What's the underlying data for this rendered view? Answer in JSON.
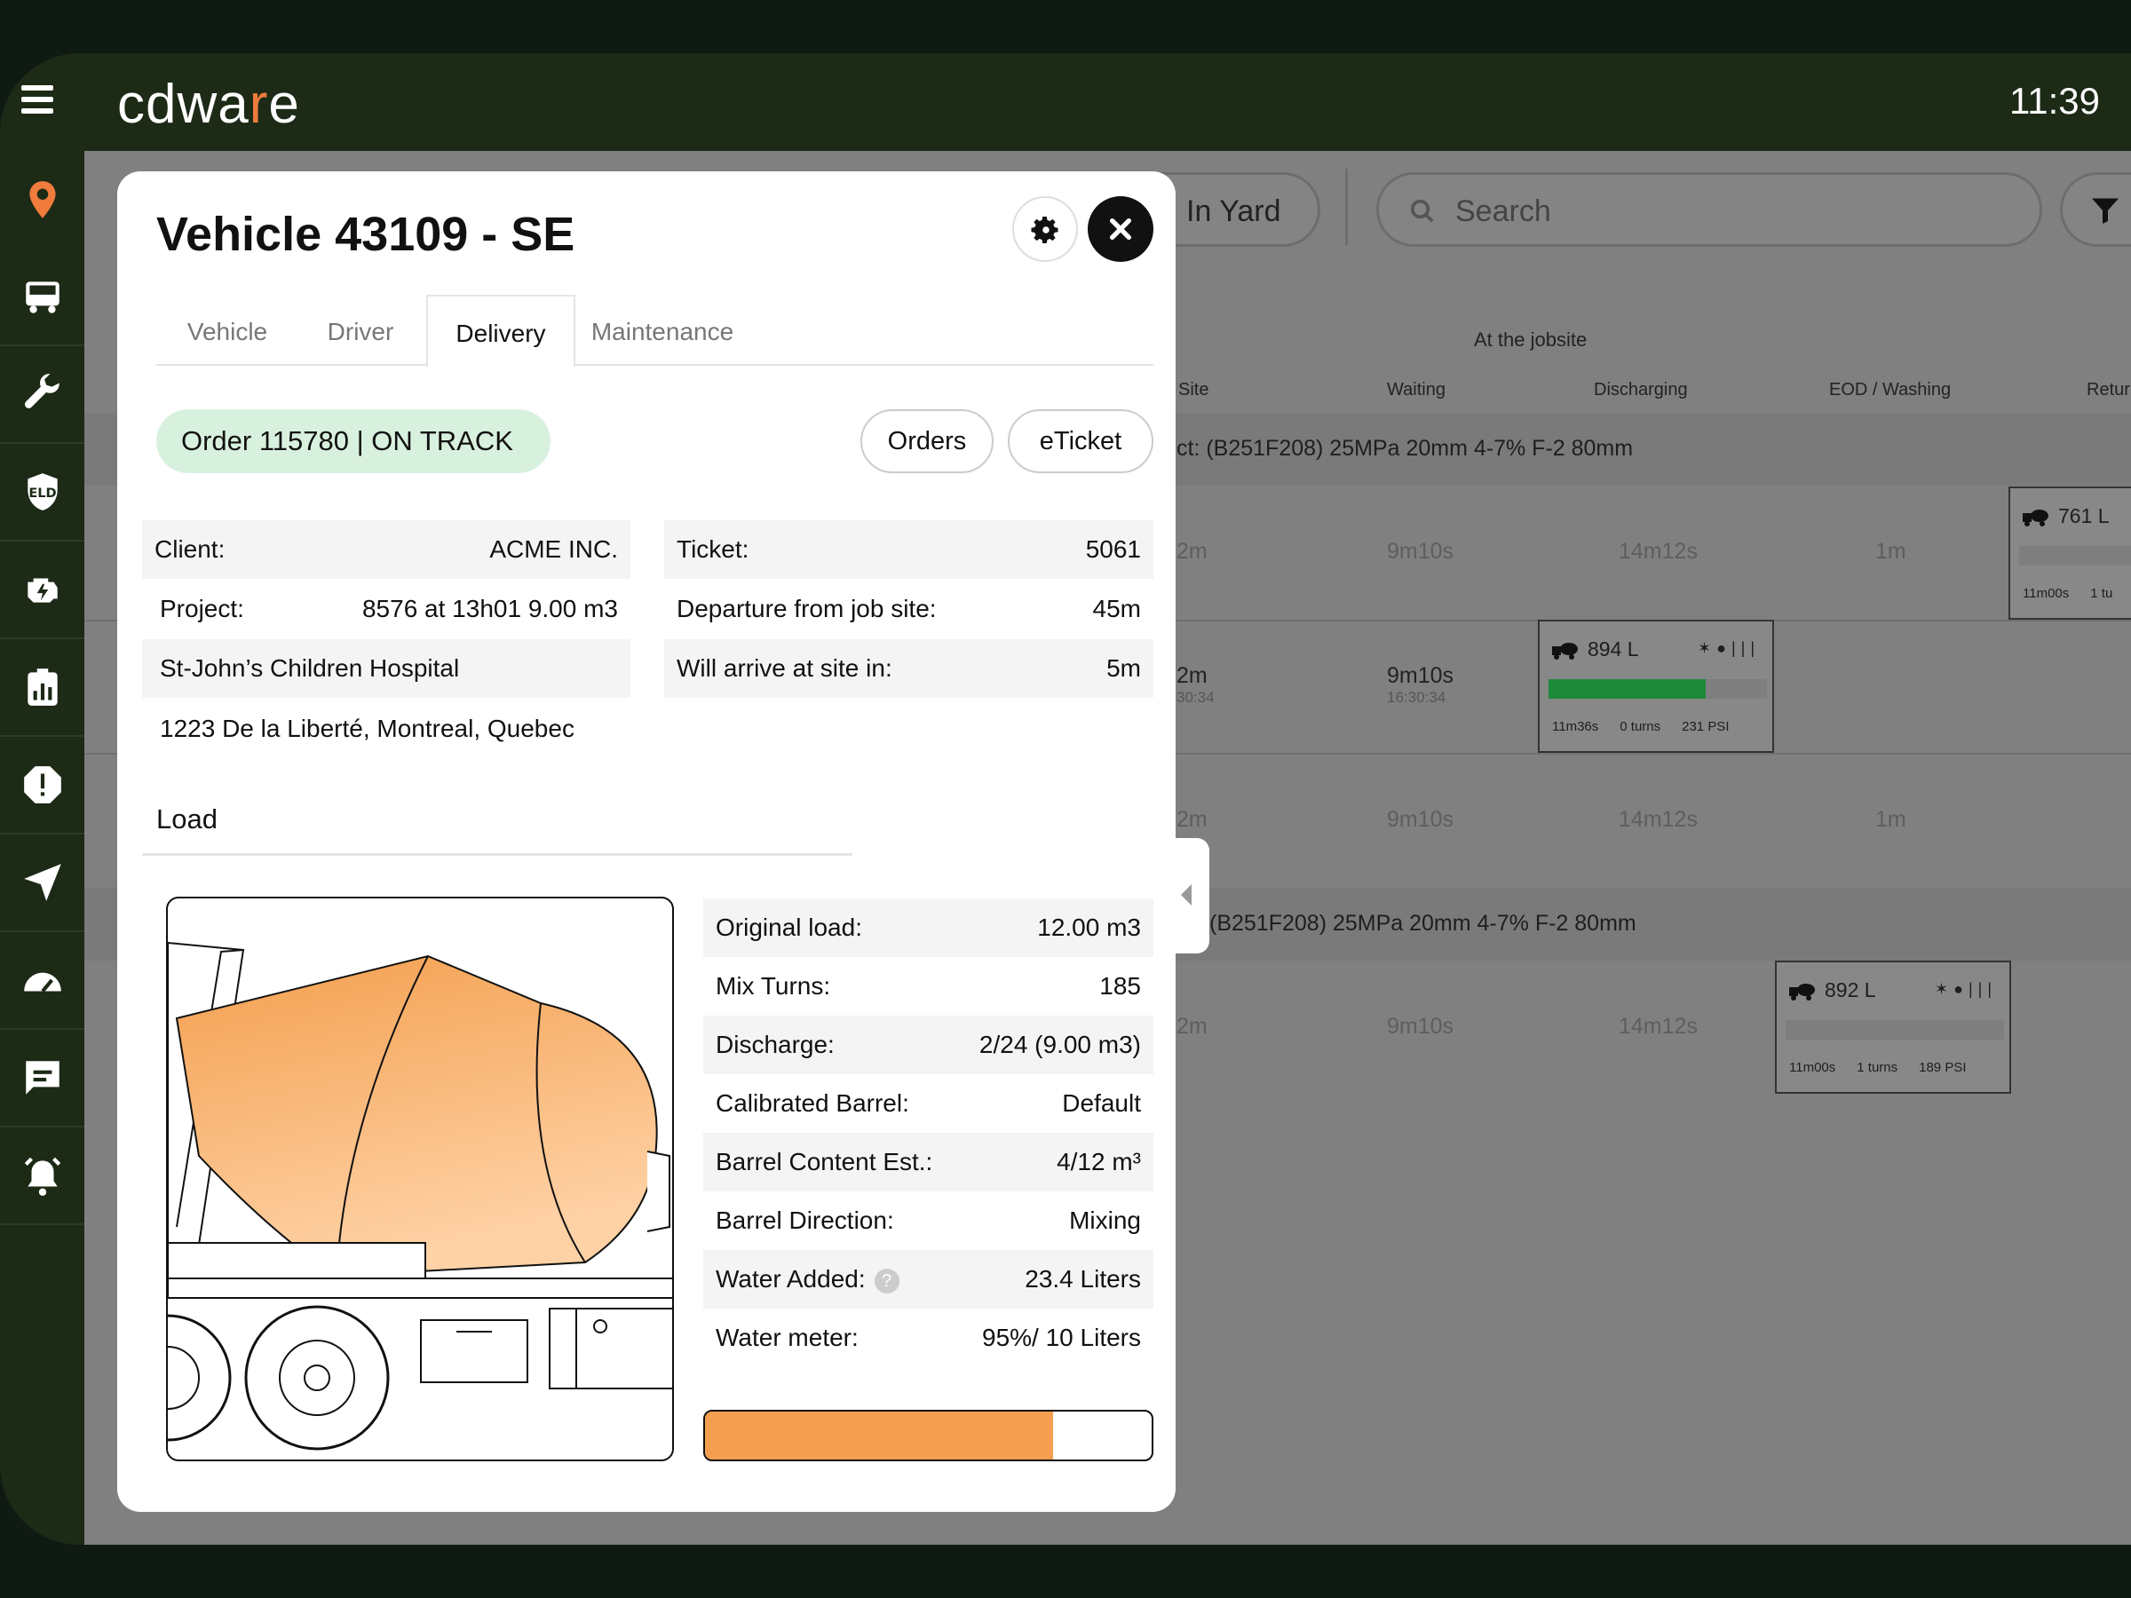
{
  "app": {
    "logo_pre": "cdwa",
    "logo_accent": "r",
    "logo_post": "e",
    "clock": "11:39"
  },
  "colors": {
    "accent": "#ef7b3d",
    "frame": "#1c2a16",
    "on_track_bg": "#d8f1de",
    "load_fill": "#f39f4f",
    "progress_green": "#1c8a3a"
  },
  "sidebar": {
    "items": [
      {
        "name": "location-pin-icon"
      },
      {
        "name": "truck-icon"
      },
      {
        "name": "wrench-icon"
      },
      {
        "name": "eld-shield-icon"
      },
      {
        "name": "engine-icon"
      },
      {
        "name": "report-chart-icon"
      },
      {
        "name": "alert-icon"
      },
      {
        "name": "navigation-icon"
      },
      {
        "name": "gauge-icon"
      },
      {
        "name": "chat-icon"
      },
      {
        "name": "alarm-bell-icon"
      }
    ]
  },
  "background": {
    "yard_label": "In Yard",
    "search_placeholder": "Search",
    "group_label": "At the jobsite",
    "columns": [
      "Site",
      "Waiting",
      "Discharging",
      "EOD / Washing",
      "Retur"
    ],
    "product_1": "ct: (B251F208) 25MPa 20mm 4-7% F-2 80mm",
    "product_2": "(B251F208) 25MPa 20mm 4-7% F-2 80mm",
    "rows": [
      {
        "c1": "2m",
        "c2": "9m10s",
        "c3": "14m12s",
        "c4": "1m"
      },
      {
        "c1": "2m",
        "c1_sub": "30:34",
        "c2": "9m10s",
        "c2_sub": "16:30:34"
      },
      {
        "c1": "2m",
        "c2": "9m10s",
        "c3": "14m12s",
        "c4": "1m"
      },
      {
        "c1": "2m",
        "c2": "9m10s",
        "c3": "14m12s"
      }
    ],
    "cards": [
      {
        "volume": "894 L",
        "progress": 0.72,
        "time": "11m36s",
        "turns": "0 turns",
        "psi": "231 PSI"
      },
      {
        "volume": "892 L",
        "progress": 0.0,
        "time": "11m00s",
        "turns": "1 turns",
        "psi": "189 PSI"
      },
      {
        "volume": "761 L",
        "time": "11m00s",
        "turns": "1 tu"
      }
    ]
  },
  "modal": {
    "title": "Vehicle 43109 - SE",
    "tabs": [
      "Vehicle",
      "Driver",
      "Delivery",
      "Maintenance"
    ],
    "active_tab": "Delivery",
    "order_status": "Order 115780 | ON TRACK",
    "orders_button": "Orders",
    "eticket_button": "eTicket",
    "client": {
      "label": "Client:",
      "value": "ACME INC."
    },
    "project": {
      "label": "Project:",
      "value": "8576 at 13h01 9.00 m3"
    },
    "site_name": "St-John’s Children Hospital",
    "address": "1223 De la Liberté, Montreal, Quebec",
    "ticket": {
      "label": "Ticket:",
      "value": "5061"
    },
    "departure": {
      "label": "Departure from job site:",
      "value": "45m"
    },
    "arrive": {
      "label": "Will arrive at site in:",
      "value": "5m"
    },
    "load_heading": "Load",
    "specs": [
      {
        "label": "Original load:",
        "value": "12.00 m3"
      },
      {
        "label": "Mix Turns:",
        "value": "185"
      },
      {
        "label": "Discharge:",
        "value": "2/24 (9.00 m3)"
      },
      {
        "label": "Calibrated Barrel:",
        "value": "Default"
      },
      {
        "label": "Barrel Content Est.:",
        "value": "4/12 m³"
      },
      {
        "label": "Barrel Direction:",
        "value": "Mixing"
      },
      {
        "label": "Water Added:",
        "value": "23.4 Liters"
      },
      {
        "label": "Water meter:",
        "value": "95%/ 10 Liters"
      }
    ],
    "help_glyph": "?",
    "barrel_fill_fraction": 0.78
  }
}
